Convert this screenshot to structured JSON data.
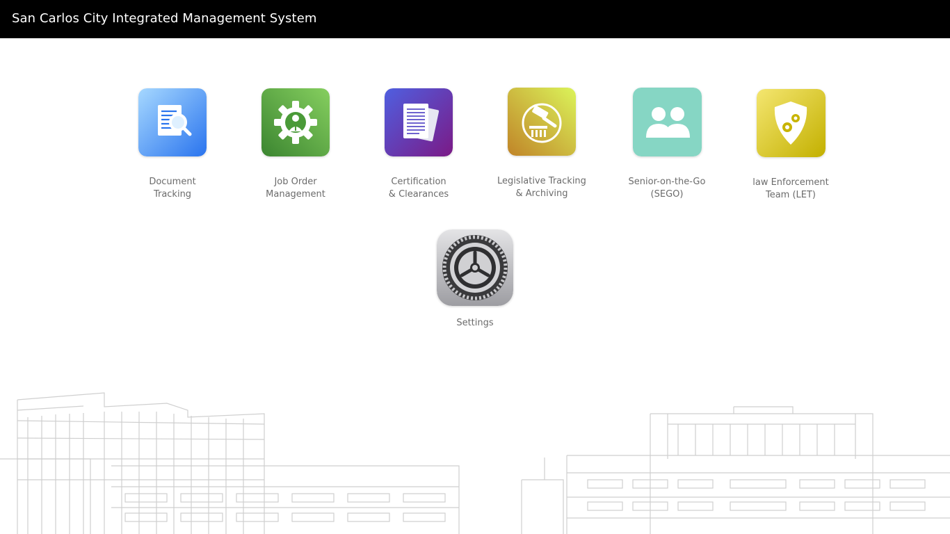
{
  "window": {
    "title": "San Carlos City Integrated Management System"
  },
  "apps": [
    {
      "label": "Document\nTracking",
      "icon": "document-search-icon",
      "color_from": "#9fd3ff",
      "color_to": "#2f7df0"
    },
    {
      "label": "Job Order\nManagement",
      "icon": "gear-worker-icon",
      "color_from": "#7bc45a",
      "color_to": "#3f8a33"
    },
    {
      "label": "Certification\n& Clearances",
      "icon": "documents-icon",
      "color_from": "#5a4fd6",
      "color_to": "#7a1f8f"
    },
    {
      "label": "Legislative Tracking\n& Archiving",
      "icon": "gavel-icon",
      "color_from": "#d8f05a",
      "color_to": "#c48a2a"
    },
    {
      "label": "Senior-on-the-Go\n(SEGO)",
      "icon": "people-icon",
      "color_from": "#8fd9c9",
      "color_to": "#7ccfb9"
    },
    {
      "label": "law Enforcement\nTeam (LET)",
      "icon": "shield-gears-icon",
      "color_from": "#f2e36a",
      "color_to": "#c9b600"
    }
  ],
  "settings": {
    "label": "Settings",
    "icon": "settings-gear-icon"
  }
}
